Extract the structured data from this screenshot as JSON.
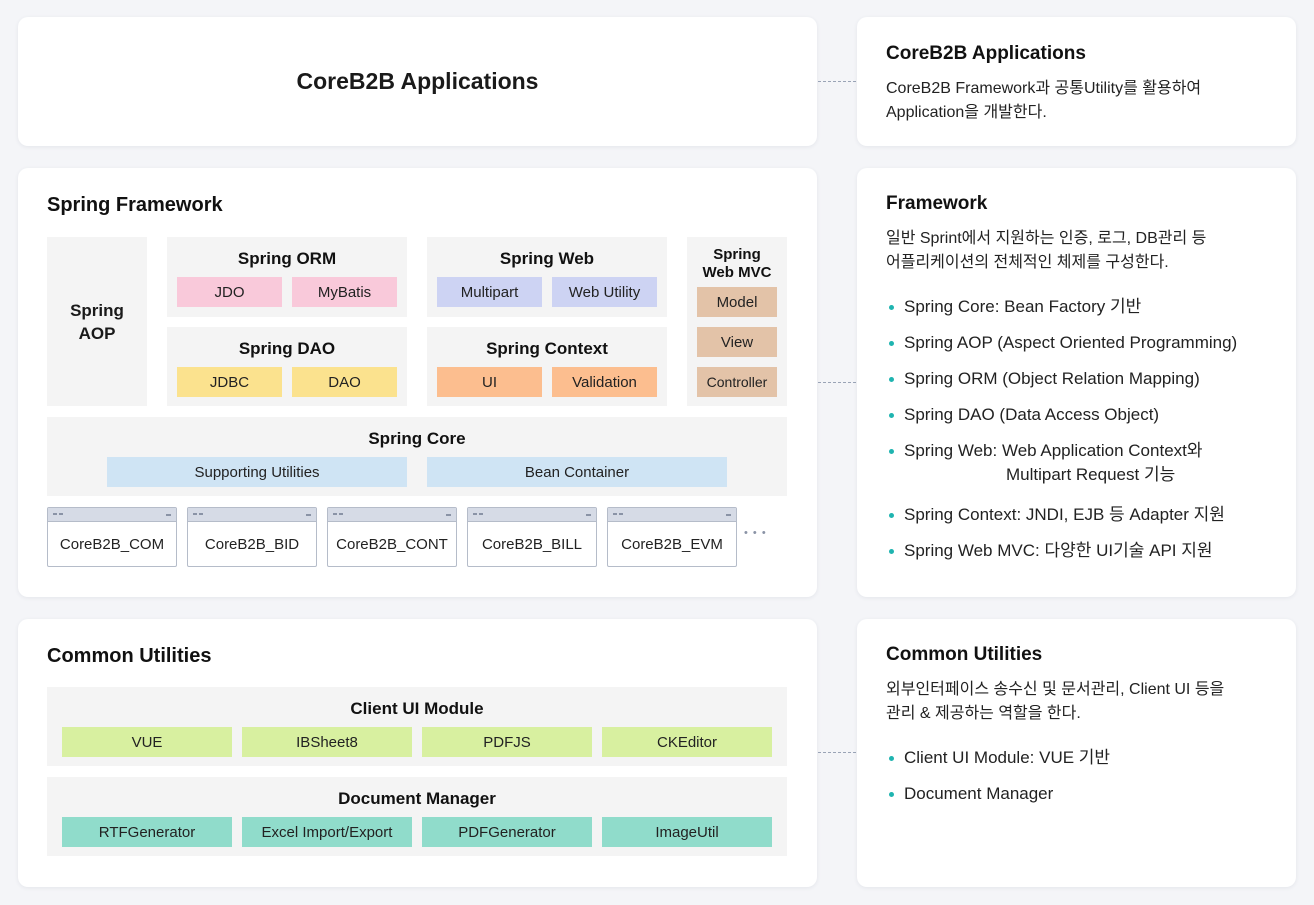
{
  "top": {
    "title": "CoreB2B Applications"
  },
  "spring": {
    "title": "Spring Framework",
    "aop": "Spring\nAOP",
    "orm": {
      "title": "Spring ORM",
      "items": [
        "JDO",
        "MyBatis"
      ]
    },
    "web": {
      "title": "Spring Web",
      "items": [
        "Multipart",
        "Web Utility"
      ]
    },
    "dao": {
      "title": "Spring DAO",
      "items": [
        "JDBC",
        "DAO"
      ]
    },
    "context": {
      "title": "Spring Context",
      "items": [
        "UI",
        "Validation"
      ]
    },
    "mvc": {
      "title": "Spring\nWeb MVC",
      "items": [
        "Model",
        "View",
        "Controller"
      ]
    },
    "core": {
      "title": "Spring Core",
      "items": [
        "Supporting Utilities",
        "Bean Container"
      ]
    },
    "modules": [
      "CoreB2B_COM",
      "CoreB2B_BID",
      "CoreB2B_CONT",
      "CoreB2B_BILL",
      "CoreB2B_EVM"
    ],
    "more": "• • •"
  },
  "common": {
    "title": "Common Utilities",
    "client_ui": {
      "title": "Client UI Module",
      "items": [
        "VUE",
        "IBSheet8",
        "PDFJS",
        "CKEditor"
      ]
    },
    "doc_manager": {
      "title": "Document Manager",
      "items": [
        "RTFGenerator",
        "Excel Import/Export",
        "PDFGenerator",
        "ImageUtil"
      ]
    }
  },
  "info": {
    "apps": {
      "title": "CoreB2B Applications",
      "desc_1": "CoreB2B Framework과 공통Utility를 활용하여",
      "desc_2": "Application을 개발한다."
    },
    "framework": {
      "title": "Framework",
      "desc_1": "일반 Sprint에서 지원하는 인증, 로그, DB관리 등",
      "desc_2": "어플리케이션의 전체적인 체제를 구성한다.",
      "bullets": [
        "Spring Core: Bean Factory 기반",
        "Spring AOP (Aspect Oriented Programming)",
        "Spring ORM (Object Relation Mapping)",
        "Spring DAO (Data Access Object)",
        "Spring Web: Web Application Context와",
        "Multipart Request 기능",
        "Spring Context: JNDI, EJB 등 Adapter 지원",
        "Spring Web MVC: 다양한 UI기술 API 지원"
      ]
    },
    "common": {
      "title": "Common Utilities",
      "desc_1": "외부인터페이스 송수신 및 문서관리, Client UI 등을",
      "desc_2": "관리 & 제공하는 역할을 한다.",
      "bullets": [
        "Client UI Module: VUE 기반",
        "Document Manager"
      ]
    }
  },
  "colors": {
    "pink": "#f9c9da",
    "lavender": "#cdd3f3",
    "yellow": "#fbe28e",
    "orange": "#fcbe8f",
    "tan": "#e3c3a8",
    "blue": "#cfe4f4",
    "lime": "#d8f0a0",
    "teal": "#90dccb",
    "bullet": "#1fb4b0"
  }
}
